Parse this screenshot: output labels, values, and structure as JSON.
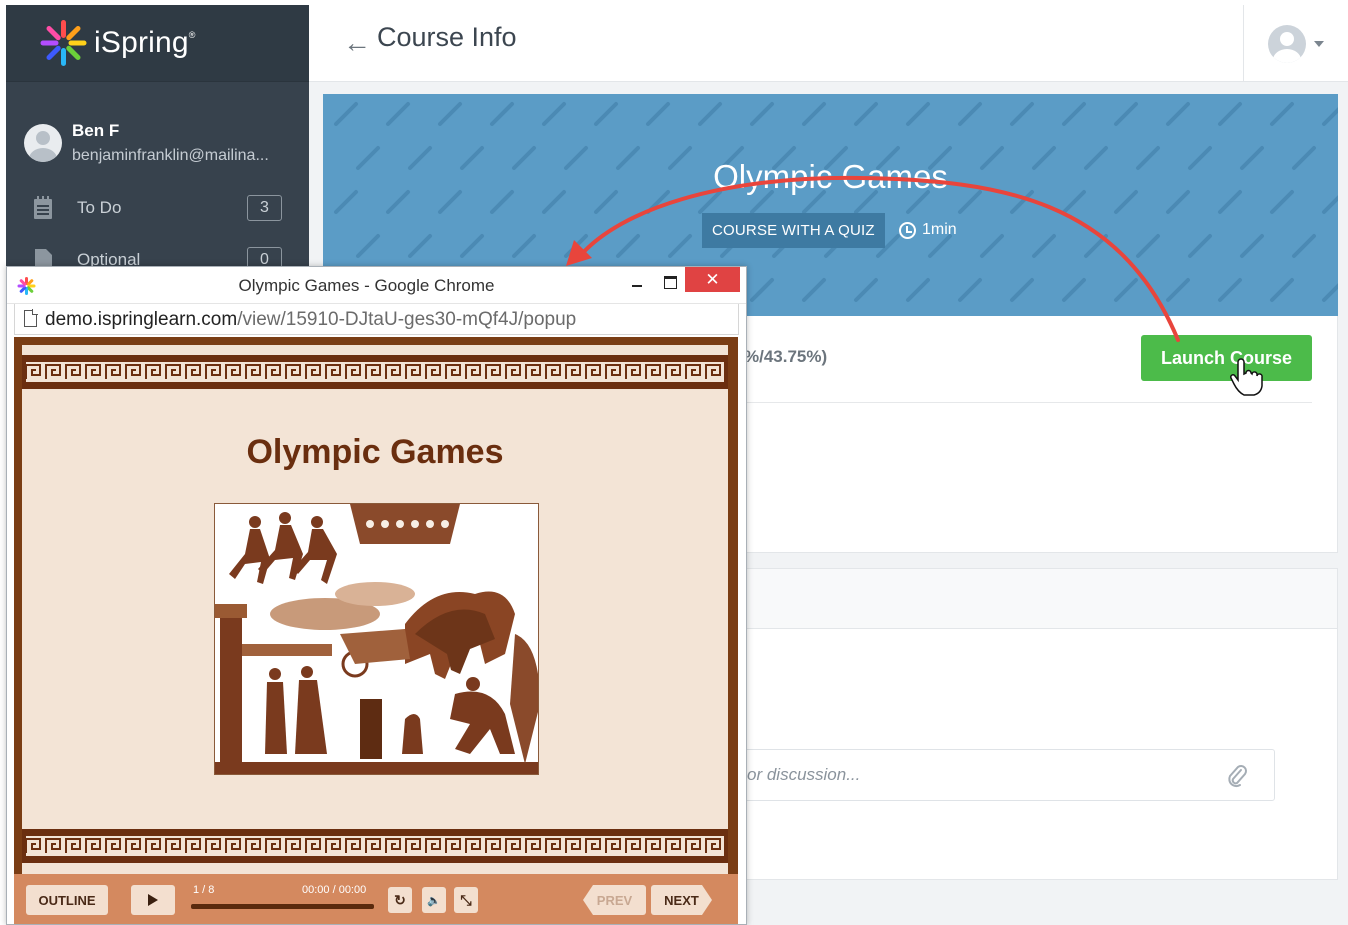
{
  "app": {
    "brand": "iSpring",
    "brand_mark": "®"
  },
  "sidebar": {
    "user_name": "Ben F",
    "user_email": "benjaminfranklin@mailina...",
    "items": [
      {
        "label": "To Do",
        "count": "3",
        "icon": "calendar-icon"
      },
      {
        "label": "Optional",
        "count": "0",
        "icon": "document-icon"
      }
    ]
  },
  "header": {
    "back_glyph": "←",
    "title": "Course Info"
  },
  "course": {
    "title": "Olympic Games",
    "type_badge": "COURSE WITH A QUIZ",
    "duration": "1min",
    "progress_fragment": "%/43.75%)",
    "launch_label": "Launch Course",
    "discussion_placeholder": "or discussion..."
  },
  "popup": {
    "window_title": "Olympic Games - Google Chrome",
    "close_glyph": "✕",
    "url_host": "demo.ispringlearn.com",
    "url_path": "/view/15910-DJtaU-ges30-mQf4J/popup",
    "slide_title": "Olympic Games",
    "controls": {
      "outline": "OUTLINE",
      "slide_counter": "1 / 8",
      "time": "00:00 / 00:00",
      "replay_glyph": "↻",
      "volume_glyph": "🔈",
      "fullscreen_glyph": "⤡",
      "prev": "PREV",
      "next": "NEXT"
    }
  },
  "colors": {
    "sidebar": "#37424d",
    "hero": "#5b9cc6",
    "launch": "#4cbb4a",
    "annotation_arrow": "#e8453c",
    "player_frame": "#7a3d15",
    "player_controls": "#d4895f"
  }
}
